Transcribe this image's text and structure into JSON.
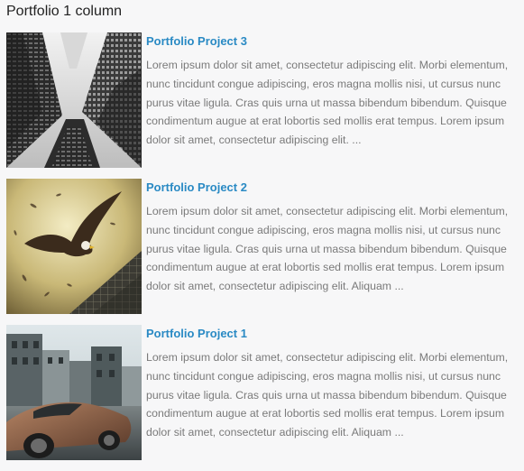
{
  "page": {
    "title": "Portfolio 1 column"
  },
  "colors": {
    "background": "#f7f7f8",
    "link": "#2a8ac4",
    "body_text": "#7a7a7a",
    "title_text": "#222222"
  },
  "portfolio": {
    "items": [
      {
        "title": "Portfolio Project 3",
        "image": "skyscrapers-photo",
        "excerpt": "Lorem ipsum dolor sit amet, consectetur adipiscing elit. Morbi elementum, nunc tincidunt congue adipiscing, eros magna mollis nisi, ut cursus nunc purus vitae ligula. Cras quis urna ut massa bibendum bibendum. Quisque condimentum augue at erat lobortis sed mollis erat tempus. Lorem ipsum dolor sit amet, consectetur adipiscing elit. ..."
      },
      {
        "title": "Portfolio Project 2",
        "image": "eagle-photo",
        "excerpt": "Lorem ipsum dolor sit amet, consectetur adipiscing elit. Morbi elementum, nunc tincidunt congue adipiscing, eros magna mollis nisi, ut cursus nunc purus vitae ligula. Cras quis urna ut massa bibendum bibendum. Quisque condimentum augue at erat lobortis sed mollis erat tempus. Lorem ipsum dolor sit amet, consectetur adipiscing elit. Aliquam ..."
      },
      {
        "title": "Portfolio Project 1",
        "image": "sports-car-photo",
        "excerpt": "Lorem ipsum dolor sit amet, consectetur adipiscing elit. Morbi elementum, nunc tincidunt congue adipiscing, eros magna mollis nisi, ut cursus nunc purus vitae ligula. Cras quis urna ut massa bibendum bibendum. Quisque condimentum augue at erat lobortis sed mollis erat tempus. Lorem ipsum dolor sit amet, consectetur adipiscing elit. Aliquam ..."
      }
    ]
  }
}
